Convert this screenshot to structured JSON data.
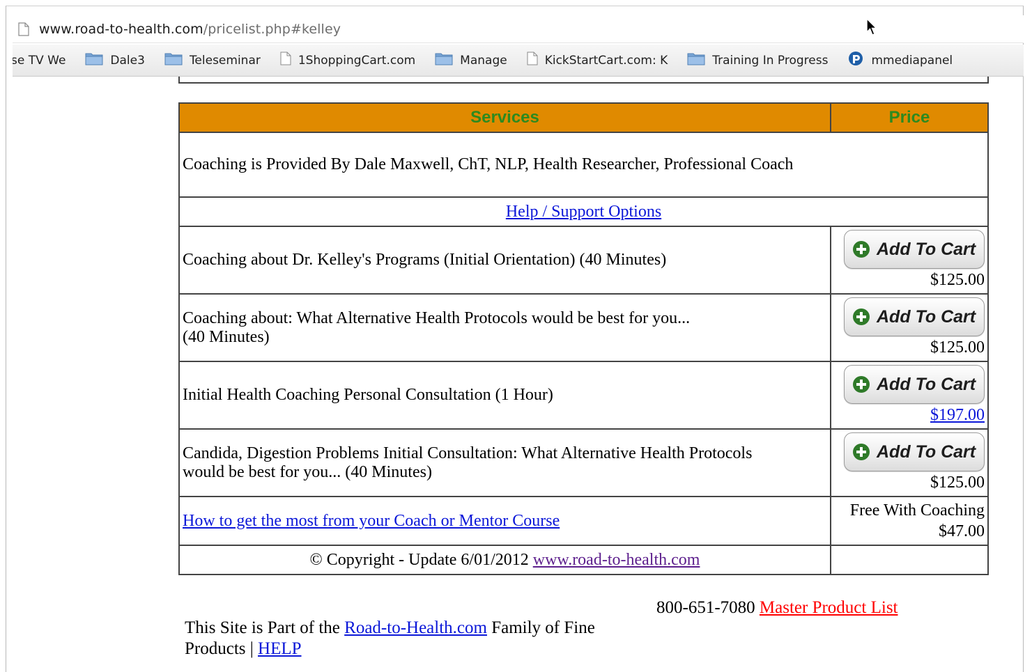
{
  "browser": {
    "url_domain": "www.road-to-health.com",
    "url_path": "/pricelist.php#kelley",
    "bookmarks": [
      {
        "label": "se TV We",
        "icon": "none"
      },
      {
        "label": "Dale3",
        "icon": "folder-icon"
      },
      {
        "label": "Teleseminar",
        "icon": "folder-icon"
      },
      {
        "label": "1ShoppingCart.com",
        "icon": "page-icon"
      },
      {
        "label": "Manage",
        "icon": "folder-icon"
      },
      {
        "label": "KickStartCart.com: K",
        "icon": "page-icon"
      },
      {
        "label": "Training In Progress",
        "icon": "folder-icon"
      },
      {
        "label": "mmediapanel",
        "icon": "mmedia-icon"
      }
    ]
  },
  "table": {
    "headers": {
      "services": "Services",
      "price": "Price"
    },
    "header_bg": "#e08a00",
    "header_text_color": "#2d8a1f",
    "coach_info": "Coaching is Provided By Dale Maxwell, ChT, NLP, Health Researcher, Professional Coach",
    "help_link": "Help / Support Options",
    "add_to_cart_label": "Add To Cart",
    "items": [
      {
        "description": "Coaching about Dr. Kelley's Programs (Initial Orientation) (40 Minutes)",
        "price": "$125.00",
        "price_is_link": false
      },
      {
        "description": "Coaching about: What Alternative Health Protocols would be best for you...",
        "description_line2": "(40 Minutes)",
        "price": "$125.00",
        "price_is_link": false
      },
      {
        "description": "Initial Health Coaching Personal Consultation (1 Hour)",
        "price": "$197.00",
        "price_is_link": true
      },
      {
        "description": "Candida, Digestion Problems Initial Consultation: What Alternative Health Protocols",
        "description_line2": "would be best for you... (40 Minutes)",
        "price": "$125.00",
        "price_is_link": false
      }
    ],
    "course": {
      "link": "How to get the most from your Coach or Mentor Course",
      "price_line1": "Free With Coaching",
      "price_line2": "$47.00"
    },
    "copyright": {
      "text": "© Copyright - Update 6/01/2012",
      "link": "www.road-to-health.com"
    }
  },
  "footer": {
    "phone": "800-651-7080",
    "master_list_link": "Master Product List",
    "family_text_1": "This Site is Part of the",
    "family_link": "Road-to-Health.com",
    "family_text_2": "Family of Fine",
    "family_text_3": "Products |",
    "help_link": "HELP"
  }
}
